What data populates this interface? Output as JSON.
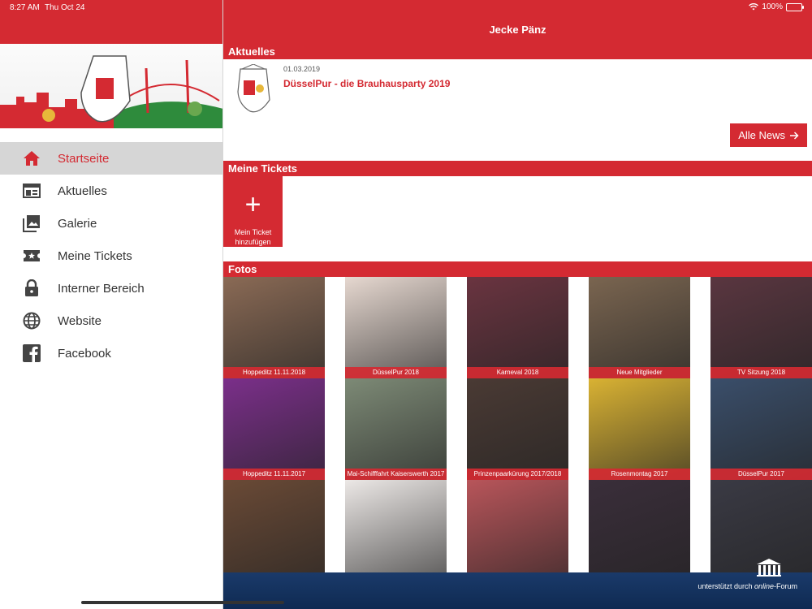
{
  "status": {
    "time": "8:27 AM",
    "date": "Thu Oct 24",
    "battery": "100%"
  },
  "app": {
    "title": "Jecke Pänz"
  },
  "sidebar": {
    "items": [
      {
        "label": "Startseite",
        "icon": "home-icon",
        "active": true
      },
      {
        "label": "Aktuelles",
        "icon": "newspaper-icon",
        "active": false
      },
      {
        "label": "Galerie",
        "icon": "gallery-icon",
        "active": false
      },
      {
        "label": "Meine Tickets",
        "icon": "ticket-icon",
        "active": false
      },
      {
        "label": "Interner Bereich",
        "icon": "lock-icon",
        "active": false
      },
      {
        "label": "Website",
        "icon": "globe-icon",
        "active": false
      },
      {
        "label": "Facebook",
        "icon": "facebook-icon",
        "active": false
      }
    ]
  },
  "sections": {
    "news_title": "Aktuelles",
    "tickets_title": "Meine Tickets",
    "photos_title": "Fotos"
  },
  "news": {
    "date": "01.03.2019",
    "title": "DüsselPur - die Brauhausparty 2019",
    "all_label": "Alle News"
  },
  "tickets": {
    "add_label_line1": "Mein Ticket",
    "add_label_line2": "hinzufügen"
  },
  "photos": [
    {
      "caption": "Hoppeditz 11.11.2018",
      "color": "#8a6a55"
    },
    {
      "caption": "DüsselPur 2018",
      "color": "#e6d8d0"
    },
    {
      "caption": "Karneval 2018",
      "color": "#6a3440"
    },
    {
      "caption": "Neue Mitglieder",
      "color": "#7a6550"
    },
    {
      "caption": "TV Sitzung 2018",
      "color": "#5a3640"
    },
    {
      "caption": "Hoppeditz 11.11.2017",
      "color": "#7b2f8a"
    },
    {
      "caption": "Mai-Schifffahrt Kaiserswerth 2017",
      "color": "#7d8a76"
    },
    {
      "caption": "Prinzenpaarkürung 2017/2018",
      "color": "#4a3a34"
    },
    {
      "caption": "Rosenmontag 2017",
      "color": "#d9b233"
    },
    {
      "caption": "DüsselPur 2017",
      "color": "#3a4e6a"
    },
    {
      "caption": "",
      "color": "#6a4a36"
    },
    {
      "caption": "",
      "color": "#ece8e6"
    },
    {
      "caption": "",
      "color": "#b8555a"
    },
    {
      "caption": "",
      "color": "#3a2e3a"
    },
    {
      "caption": "",
      "color": "#3a3a44"
    }
  ],
  "footer": {
    "credit_prefix": "unterstützt durch ",
    "credit_brand": "online",
    "credit_suffix": "-Forum"
  },
  "colors": {
    "brand_red": "#d42a32",
    "footer_blue": "#1a3a6a"
  }
}
